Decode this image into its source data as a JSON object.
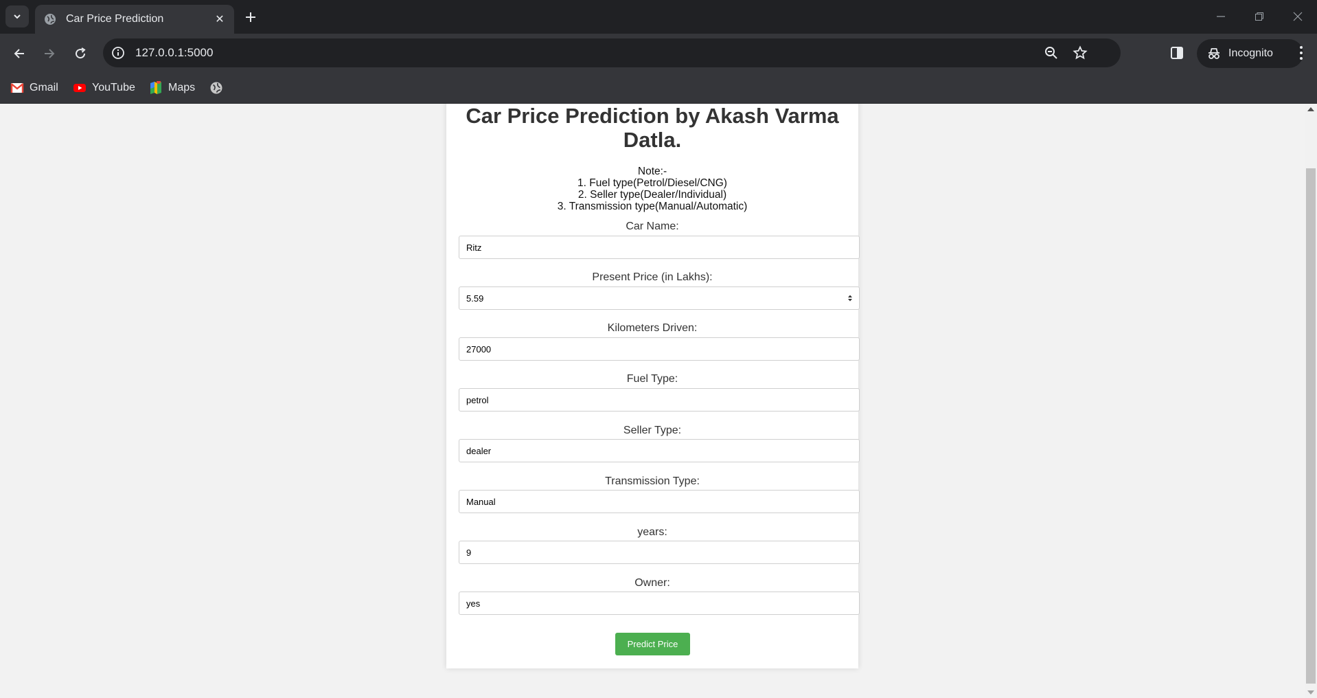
{
  "browser": {
    "tab_title": "Car Price Prediction",
    "url": "127.0.0.1:5000",
    "incognito_label": "Incognito",
    "bookmarks": [
      "Gmail",
      "YouTube",
      "Maps"
    ]
  },
  "page": {
    "heading": "Car Price Prediction by Akash Varma Datla.",
    "note_lines": [
      "Note:-",
      "1. Fuel type(Petrol/Diesel/CNG)",
      "2. Seller type(Dealer/Individual)",
      "3. Transmission type(Manual/Automatic)"
    ],
    "fields": [
      {
        "label": "Car Name:",
        "value": "Ritz"
      },
      {
        "label": "Present Price (in Lakhs):",
        "value": "5.59"
      },
      {
        "label": "Kilometers Driven:",
        "value": "27000"
      },
      {
        "label": "Fuel Type:",
        "value": "petrol"
      },
      {
        "label": "Seller Type:",
        "value": "dealer"
      },
      {
        "label": "Transmission Type:",
        "value": "Manual"
      },
      {
        "label": "years:",
        "value": "9"
      },
      {
        "label": "Owner:",
        "value": "yes"
      }
    ],
    "submit_label": "Predict Price"
  }
}
